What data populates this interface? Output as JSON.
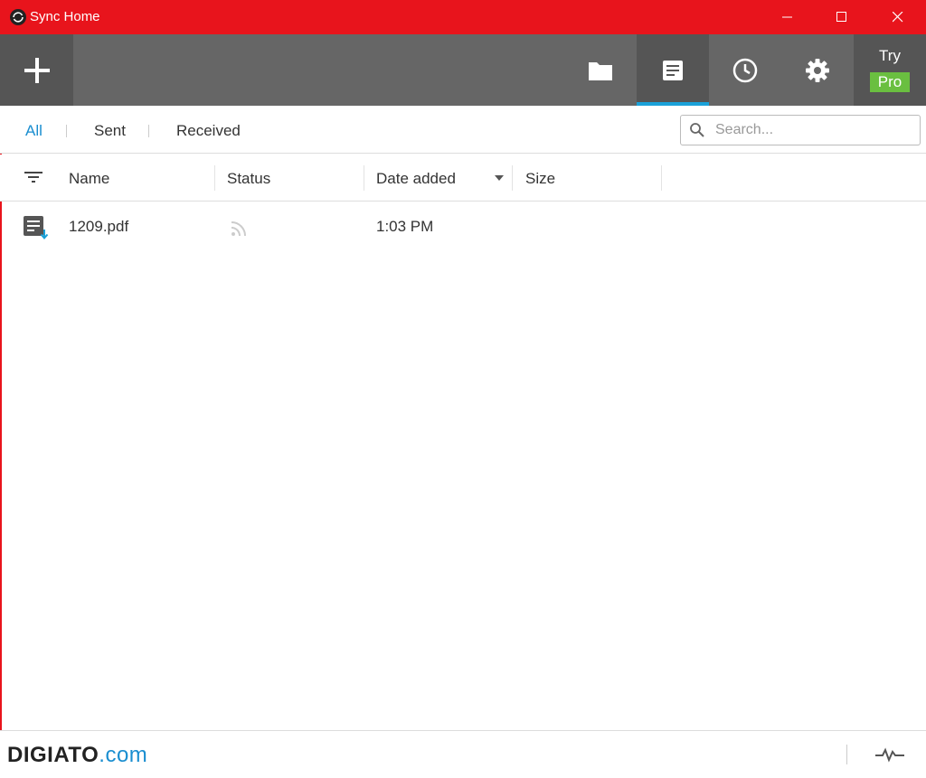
{
  "window": {
    "title": "Sync Home"
  },
  "toolbar": {
    "add_icon": "plus-icon",
    "buttons": [
      {
        "name": "folders",
        "icon": "folder-icon"
      },
      {
        "name": "files",
        "icon": "document-icon",
        "active": true
      },
      {
        "name": "history",
        "icon": "clock-icon"
      },
      {
        "name": "settings",
        "icon": "gear-icon"
      }
    ],
    "try_label": "Try",
    "pro_label": "Pro"
  },
  "filters": {
    "tabs": [
      "All",
      "Sent",
      "Received"
    ],
    "active": "All"
  },
  "search": {
    "placeholder": "Search...",
    "value": ""
  },
  "table": {
    "columns": [
      "Name",
      "Status",
      "Date added",
      "Size"
    ],
    "sorted_by": "Date added",
    "rows": [
      {
        "name": "1209.pdf",
        "status_icon": "rss-signal-icon",
        "date_added": "1:03 PM",
        "size": ""
      }
    ]
  },
  "footer": {
    "watermark_main": "DIGIATO",
    "watermark_domain": ".com"
  },
  "colors": {
    "titlebar": "#e8141c",
    "toolbar": "#666666",
    "accent": "#1aa1d8",
    "pro_badge": "#6abf40"
  }
}
